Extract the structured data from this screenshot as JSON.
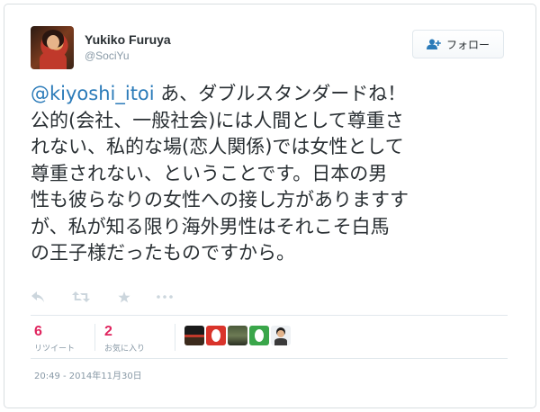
{
  "user": {
    "name": "Yukiko Furuya",
    "handle": "@SociYu"
  },
  "follow_button": {
    "label": "フォロー",
    "icon": "person-add-icon"
  },
  "tweet": {
    "mention": "@kiyoshi_itoi",
    "lines": [
      " あ、ダブルスタンダードね！",
      "公的(会社、一般社会)には人間として尊重さ",
      "れない、私的な場(恋人関係)では女性として",
      "尊重されない、ということです。日本の男",
      "性も彼らなりの女性への接し方がありますす",
      "が、私が知る限り海外男性はそれこそ白馬",
      "の王子様だったものですから。"
    ]
  },
  "actions": {
    "reply": "reply-icon",
    "retweet": "retweet-icon",
    "favorite": "star-icon",
    "more": "more-icon"
  },
  "stats": {
    "retweets": {
      "count": "6",
      "label": "リツイート"
    },
    "favorites": {
      "count": "2",
      "label": "お気に入り"
    }
  },
  "timestamp": "20:49 - 2014年11月30日",
  "colors": {
    "link": "#2b7bb9",
    "stat": "#e0245e",
    "muted": "#8899a6",
    "icon": "#ccd6dd"
  }
}
